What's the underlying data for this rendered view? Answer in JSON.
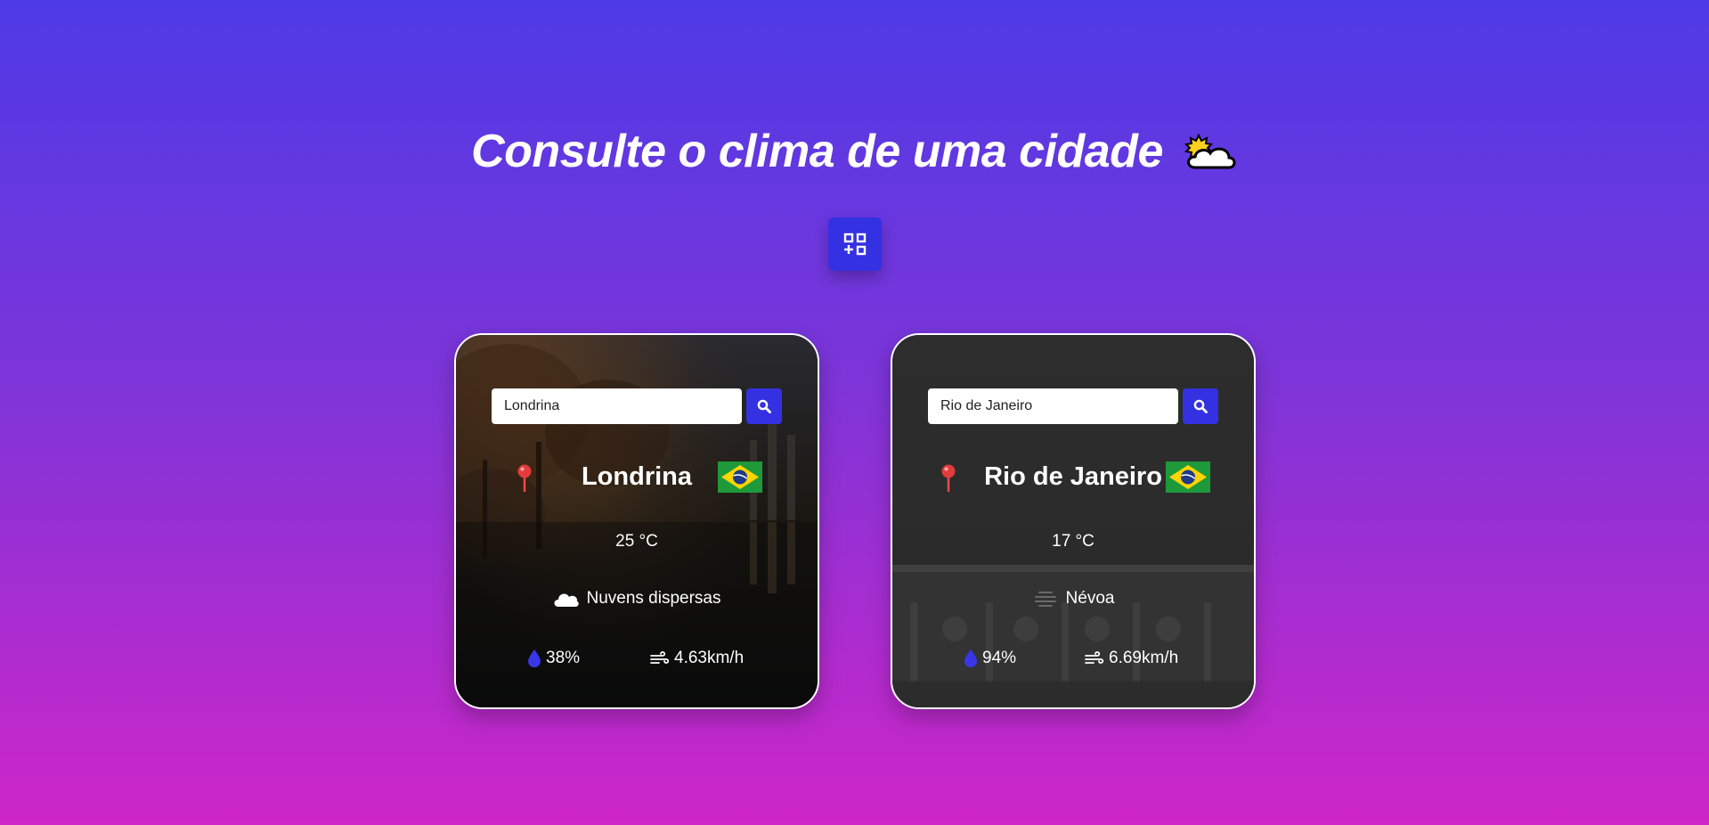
{
  "header": {
    "title": "Consulte o clima de uma cidade",
    "title_icon": "sun-behind-cloud-icon",
    "add_button_icon": "add-widget-icon"
  },
  "colors": {
    "gradient_top": "#4e3ae6",
    "gradient_bottom": "#ce26c8",
    "accent": "#3431e2"
  },
  "cards": [
    {
      "search_value": "Londrina",
      "search_icon": "search-icon",
      "location_icon": "round-pushpin-icon",
      "city": "Londrina",
      "flag_icon": "brazil-flag-icon",
      "temperature": "25 °C",
      "condition_icon": "cloud-icon",
      "condition": "Nuvens dispersas",
      "humidity": "38%",
      "wind": "4.63km/h"
    },
    {
      "search_value": "Rio de Janeiro",
      "search_icon": "search-icon",
      "location_icon": "round-pushpin-icon",
      "city": "Rio de Janeiro",
      "flag_icon": "brazil-flag-icon",
      "temperature": "17 °C",
      "condition_icon": "mist-icon",
      "condition": "Névoa",
      "humidity": "94%",
      "wind": "6.69km/h"
    }
  ]
}
